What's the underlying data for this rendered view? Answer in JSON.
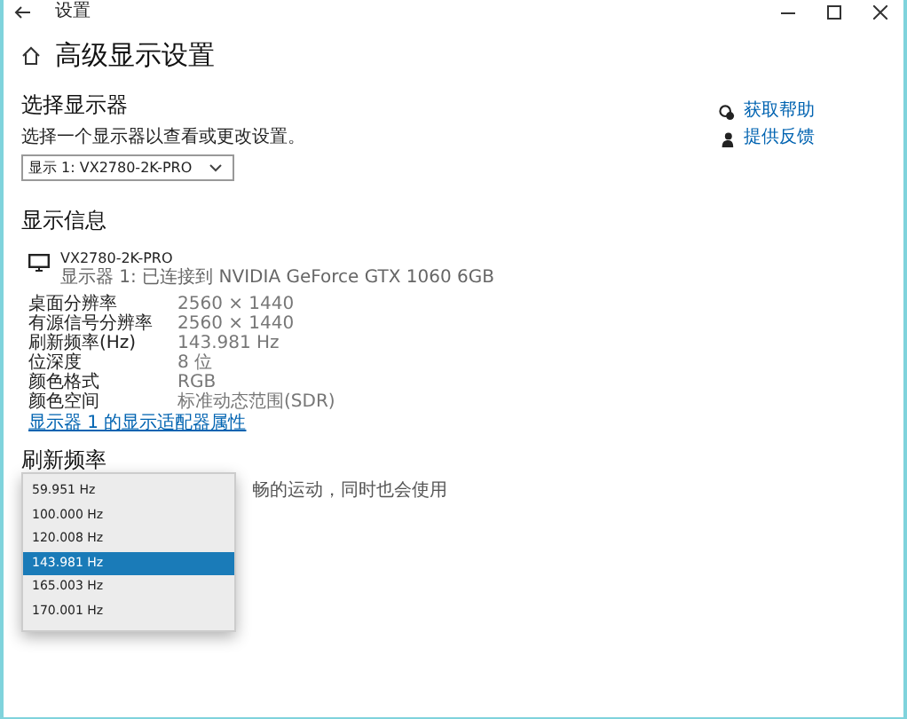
{
  "window": {
    "title": "设置"
  },
  "page_title": "高级显示设置",
  "choose_display": {
    "heading": "选择显示器",
    "hint": "选择一个显示器以查看或更改设置。",
    "dropdown": {
      "value": "显示 1: VX2780-2K-PRO"
    }
  },
  "display_info": {
    "heading": "显示信息",
    "monitor": {
      "name": "VX2780-2K-PRO",
      "connection": "显示器 1: 已连接到 NVIDIA GeForce GTX 1060 6GB"
    },
    "rows": [
      {
        "label": "桌面分辨率",
        "value": "2560 × 1440"
      },
      {
        "label": "有源信号分辨率",
        "value": "2560 × 1440"
      },
      {
        "label": "刷新频率(Hz)",
        "value": "143.981 Hz"
      },
      {
        "label": "位深度",
        "value": "8 位"
      },
      {
        "label": "颜色格式",
        "value": "RGB"
      },
      {
        "label": "颜色空间",
        "value": "标准动态范围(SDR)"
      }
    ],
    "link": "显示器 1 的显示适配器属性"
  },
  "refresh": {
    "heading": "刷新频率",
    "description": "畅的运动，同时也会使用",
    "options": [
      {
        "label": "59.951 Hz",
        "selected": false
      },
      {
        "label": "100.000 Hz",
        "selected": false
      },
      {
        "label": "120.008 Hz",
        "selected": false
      },
      {
        "label": "143.981 Hz",
        "selected": true
      },
      {
        "label": "165.003 Hz",
        "selected": false
      },
      {
        "label": "170.001 Hz",
        "selected": false
      }
    ]
  },
  "side_links": [
    {
      "kind": "help",
      "label": "获取帮助"
    },
    {
      "kind": "feedback",
      "label": "提供反馈"
    }
  ]
}
